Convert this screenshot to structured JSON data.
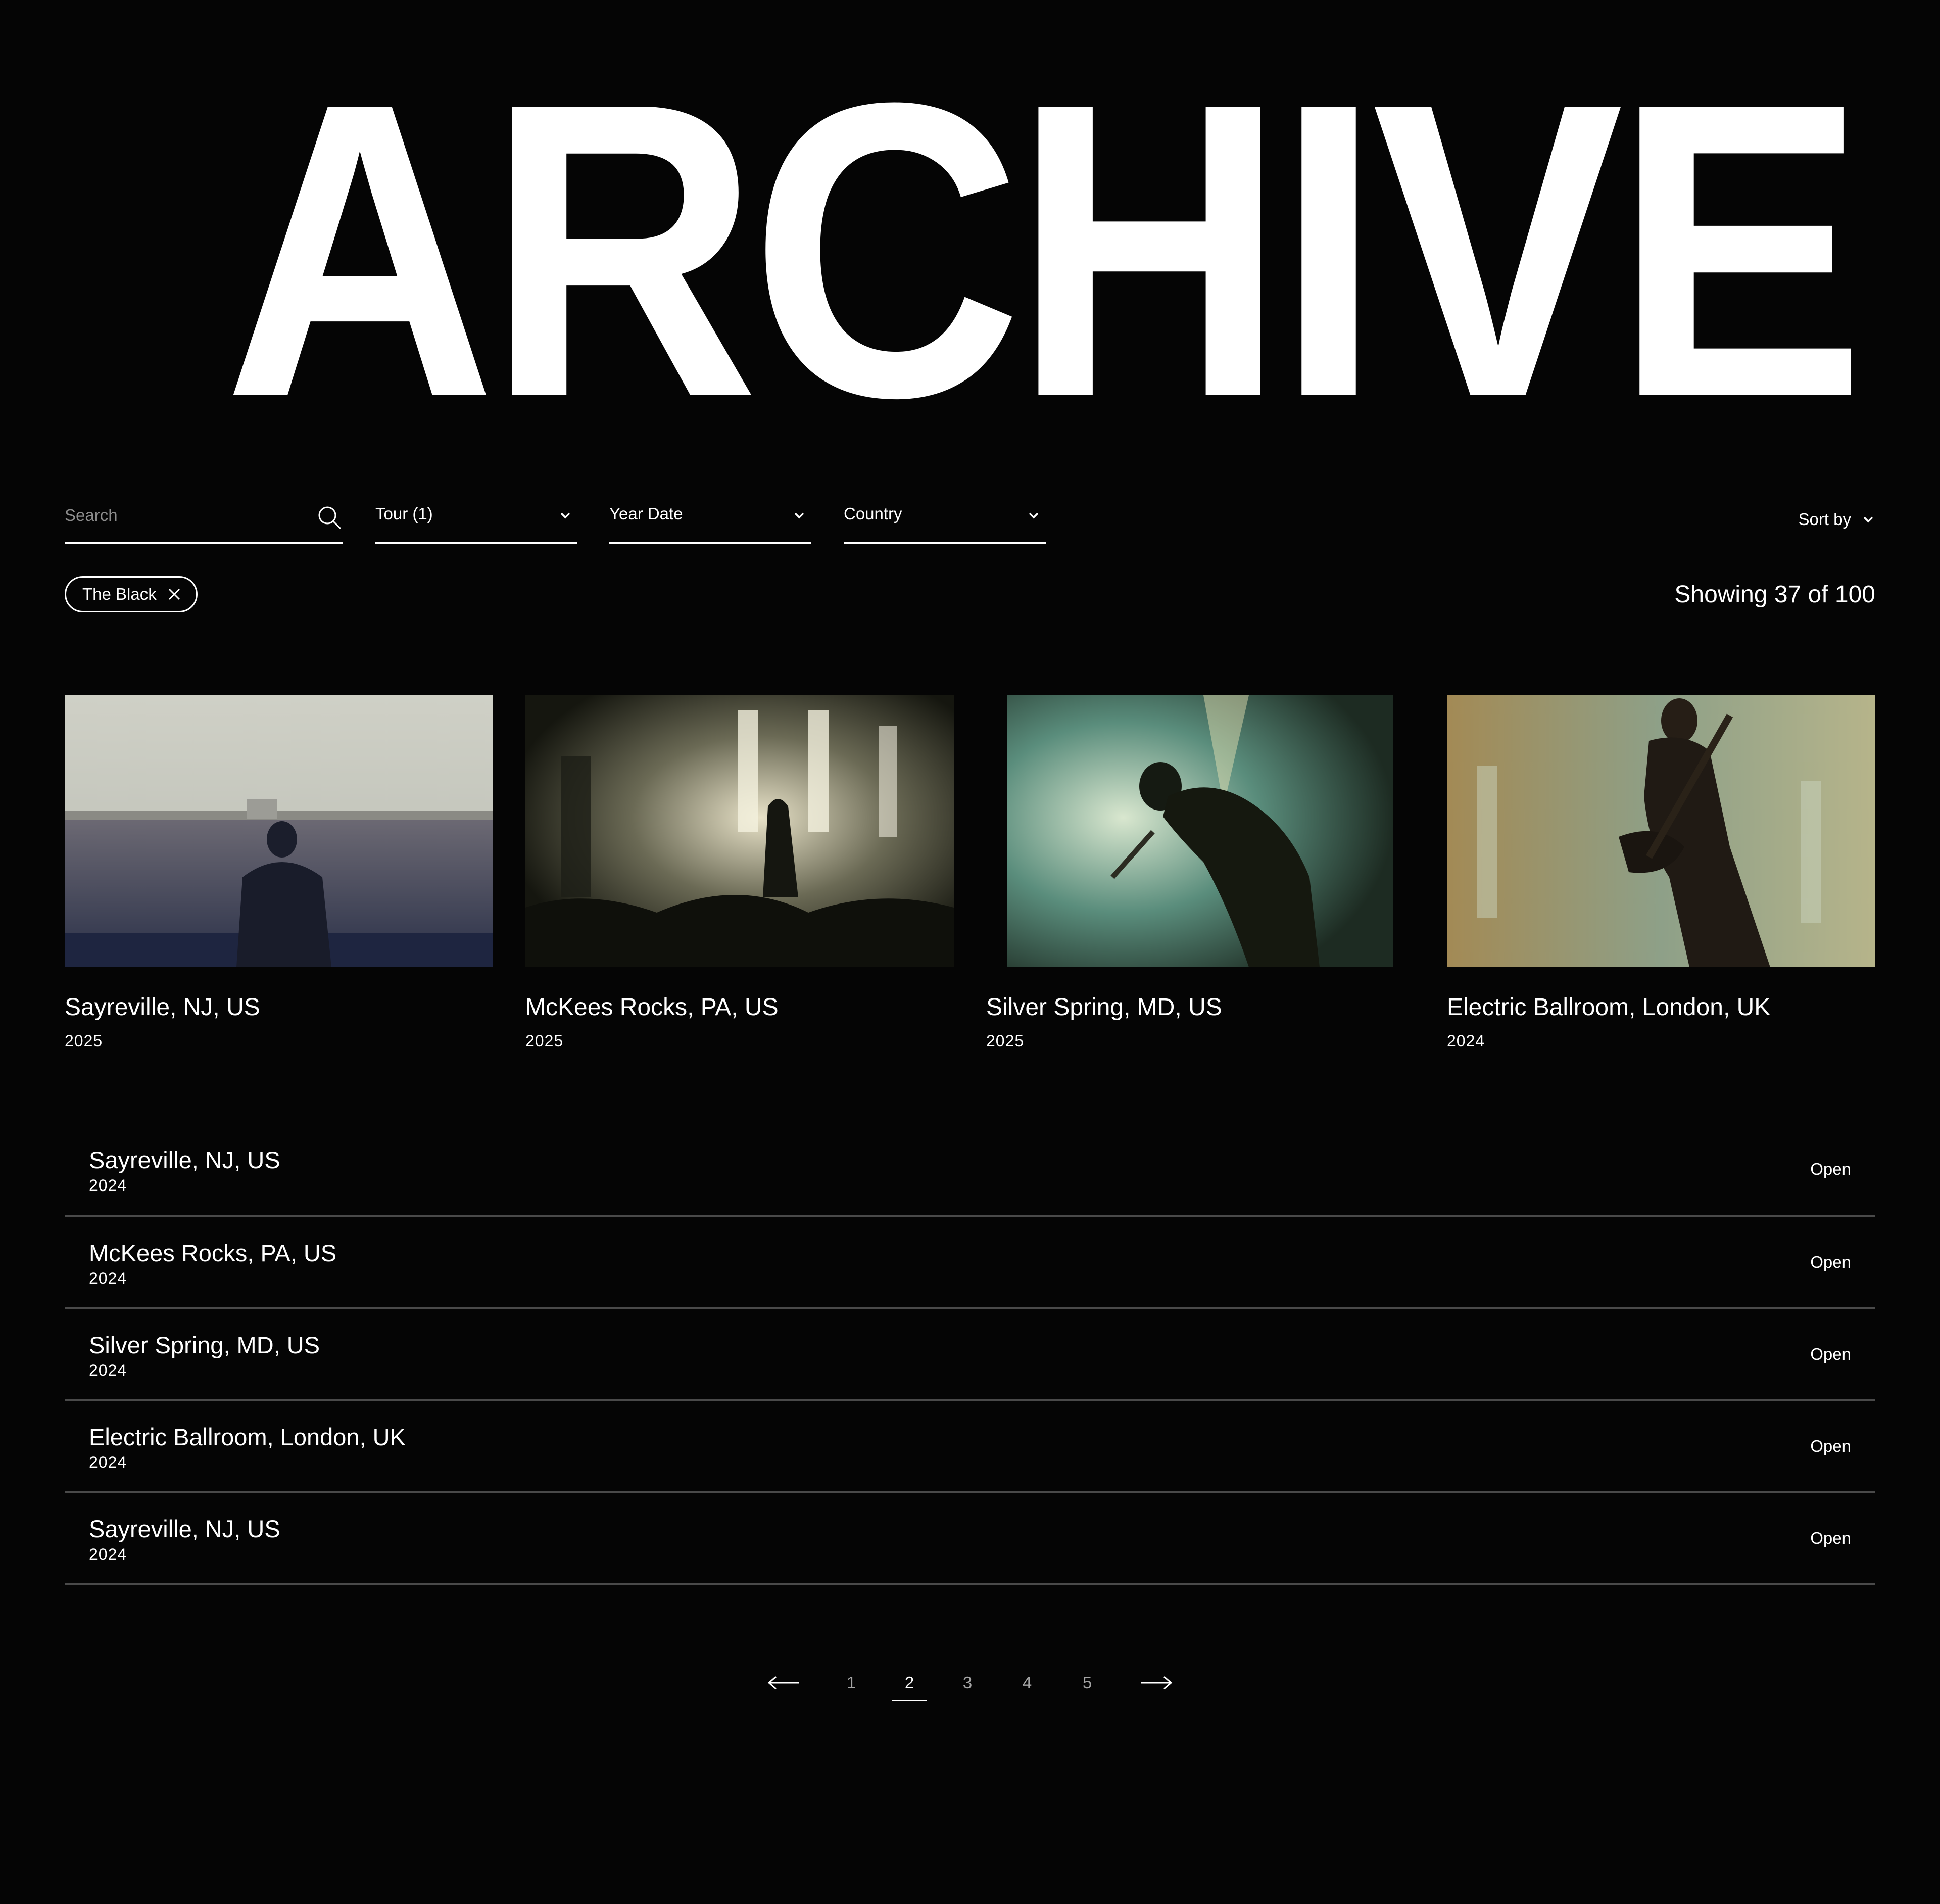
{
  "hero": {
    "title": "ARCHIVE"
  },
  "filters": {
    "search_placeholder": "Search",
    "tour_label": "Tour (1)",
    "year_label": "Year Date",
    "country_label": "Country",
    "sort_label": "Sort by"
  },
  "active_filters": [
    {
      "label": "The Black"
    }
  ],
  "results": {
    "count_text": "Showing 37 of 100"
  },
  "cards": [
    {
      "title": "Sayreville, NJ, US",
      "year": "2025",
      "image": "crowd-view-photo"
    },
    {
      "title": "McKees Rocks, PA, US",
      "year": "2025",
      "image": "stage-backlit-photo"
    },
    {
      "title": "Silver Spring, MD, US",
      "year": "2025",
      "image": "singer-silhouette-photo"
    },
    {
      "title": "Electric Ballroom, London, UK",
      "year": "2024",
      "image": "guitarist-photo"
    }
  ],
  "list": {
    "open_label": "Open",
    "rows": [
      {
        "title": "Sayreville, NJ, US",
        "year": "2024"
      },
      {
        "title": "McKees Rocks, PA, US",
        "year": "2024"
      },
      {
        "title": "Silver Spring, MD, US",
        "year": "2024"
      },
      {
        "title": "Electric Ballroom, London, UK",
        "year": "2024"
      },
      {
        "title": "Sayreville, NJ, US",
        "year": "2024"
      }
    ]
  },
  "pagination": {
    "pages": [
      "1",
      "2",
      "3",
      "4",
      "5"
    ],
    "current": "2"
  },
  "colors": {
    "background": "#050505",
    "text": "#ffffff",
    "muted": "#9a9a9a",
    "divider": "#4a4a4a"
  }
}
